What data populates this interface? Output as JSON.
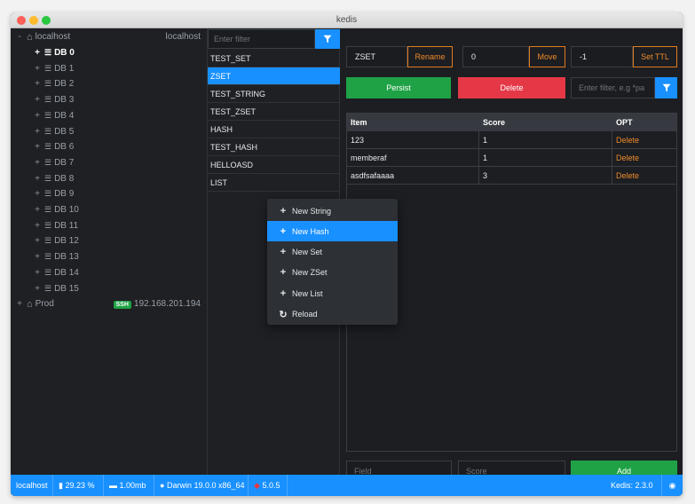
{
  "window": {
    "title": "kedis"
  },
  "sidebar": {
    "connections": [
      {
        "name": "localhost",
        "host": "localhost",
        "expanded": true
      },
      {
        "name": "Prod",
        "badge": "SSH",
        "host": "192.168.201.194",
        "expanded": false
      }
    ],
    "dbs": [
      "DB 0",
      "DB 1",
      "DB 2",
      "DB 3",
      "DB 4",
      "DB 5",
      "DB 6",
      "DB 7",
      "DB 8",
      "DB 9",
      "DB 10",
      "DB 11",
      "DB 12",
      "DB 13",
      "DB 14",
      "DB 15"
    ],
    "active_db": "DB 0",
    "expand_open": "-",
    "expand_closed": "+"
  },
  "keys": {
    "filter_placeholder": "Enter filter",
    "items": [
      "TEST_SET",
      "ZSET",
      "TEST_STRING",
      "TEST_ZSET",
      "HASH",
      "TEST_HASH",
      "HELLOASD",
      "LIST"
    ],
    "selected": "ZSET"
  },
  "detail": {
    "key_name": "ZSET",
    "rename_label": "Rename",
    "db_value": "0",
    "move_label": "Move",
    "ttl_value": "-1",
    "set_ttl_label": "Set TTL",
    "persist_label": "Persist",
    "delete_label": "Delete",
    "filter_placeholder": "Enter filter, e.g *pa",
    "table": {
      "headers": [
        "Item",
        "Score",
        "OPT"
      ],
      "rows": [
        {
          "item": "123",
          "score": "1",
          "opt": "Delete"
        },
        {
          "item": "memberaf",
          "score": "1",
          "opt": "Delete"
        },
        {
          "item": "asdfsafaaaa",
          "score": "3",
          "opt": "Delete"
        }
      ]
    },
    "field_placeholder": "Field",
    "score_placeholder": "Score",
    "add_label": "Add"
  },
  "context_menu": {
    "items": [
      {
        "icon": "plus-icon",
        "label": "New String"
      },
      {
        "icon": "plus-icon",
        "label": "New Hash",
        "highlighted": true
      },
      {
        "icon": "plus-icon",
        "label": "New Set"
      },
      {
        "icon": "plus-icon",
        "label": "New ZSet"
      },
      {
        "icon": "plus-icon",
        "label": "New List"
      },
      {
        "icon": "reload-icon",
        "label": "Reload"
      }
    ]
  },
  "statusbar": {
    "host": "localhost",
    "cpu": "29.23 %",
    "memory": "1.00mb",
    "os": "Darwin 19.0.0 x86_64",
    "redis_version": "5.0.5",
    "app_version": "Kedis: 2.3.0"
  },
  "colors": {
    "accent": "#1890ff",
    "success": "#1fa245",
    "danger": "#e53847",
    "warning": "#f08a2a"
  }
}
